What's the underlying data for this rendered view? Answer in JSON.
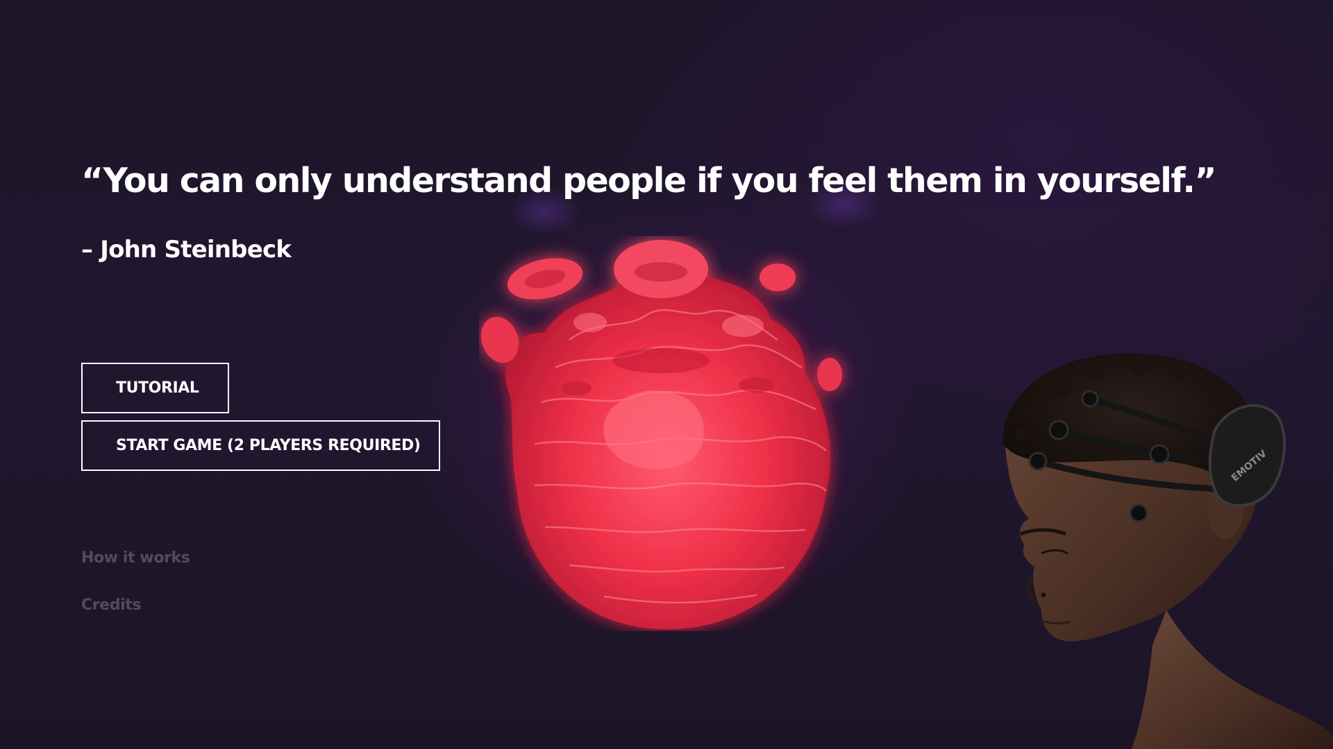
{
  "hero": {
    "quote": "“You can only understand people if you feel them in yourself.”",
    "author": "– John Steinbeck"
  },
  "menu": {
    "tutorial_label": "TUTORIAL",
    "start_label": "START GAME (2 PLAYERS REQUIRED)"
  },
  "links": {
    "how_it_works": "How it works",
    "credits": "Credits"
  },
  "headset": {
    "brand": "EMOTIV"
  },
  "colors": {
    "background": "#1e1428",
    "orb": "#ff3a55",
    "text": "#ffffff",
    "muted_link": "#55485f"
  }
}
